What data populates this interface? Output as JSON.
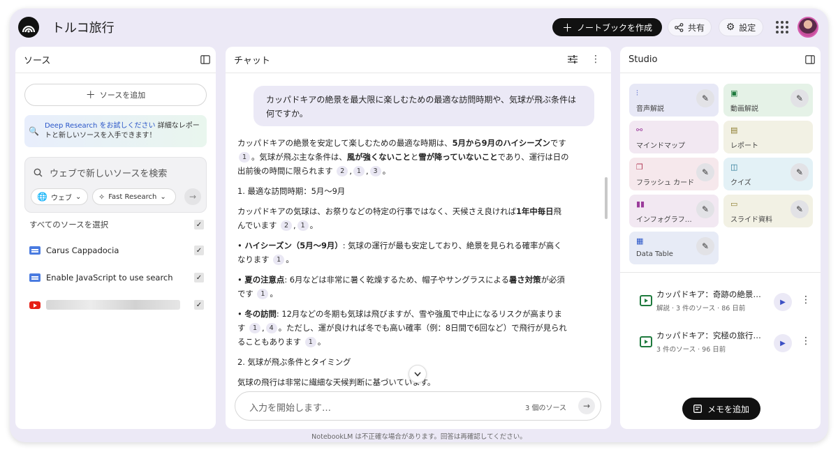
{
  "header": {
    "notebook_title": "トルコ旅行",
    "create_button": "ノートブックを作成",
    "share_button": "共有",
    "settings_button": "設定"
  },
  "sources": {
    "title": "ソース",
    "add_button": "ソースを追加",
    "deep_research_link": "Deep Research をお試しください",
    "deep_research_text": "詳細なレポートと新しいソースを入手できます！",
    "search_placeholder": "ウェブで新しいソースを検索",
    "web_chip": "ウェブ",
    "research_chip": "Fast Research",
    "select_all": "すべてのソースを選択",
    "items": [
      {
        "label": "Carus Cappadocia",
        "icon": "document-icon"
      },
      {
        "label": "Enable JavaScript to use search",
        "icon": "document-icon"
      },
      {
        "label": "",
        "icon": "youtube-icon"
      }
    ]
  },
  "chat": {
    "title": "チャット",
    "user_message": "カッパドキアの絶景を最大限に楽しむための最適な訪問時期や、気球が飛ぶ条件は何ですか。",
    "input_placeholder": "入力を開始します…",
    "source_count": "3 個のソース",
    "paragraphs": {
      "p1_a": "カッパドキアの絶景を安定して楽しむための最適な時期は、",
      "p1_b": "5月から9月のハイシーズン",
      "p1_c": "です",
      "p1_d": "。気球が飛ぶ主な条件は、",
      "p1_e": "風が強くないこと",
      "p1_f": "と",
      "p1_g": "雪が降っていないこと",
      "p1_h": "であり、運行は日の出前後の時間に限られます",
      "h1": "1. 最適な訪問時期：5月〜9月",
      "p2_a": "カッパドキアの気球は、お祭りなどの特定の行事ではなく、天候さえ良ければ",
      "p2_b": "1年中毎日",
      "p2_c": "飛んでいます",
      "b1_a": "• ",
      "b1_b": "ハイシーズン（5月〜9月）",
      "b1_c": ": 気球の運行が最も安定しており、絶景を見られる確率が高くなります",
      "b2_b": "夏の注意点",
      "b2_c": ": 6月などは非常に暑く乾燥するため、帽子やサングラスによる",
      "b2_d": "暑さ対策",
      "b2_e": "が必須です",
      "b3_b": "冬の訪問",
      "b3_c": ": 12月などの冬期も気球は飛びますが、雪や強風で中止になるリスクが高まります",
      "b3_d": "。ただし、運が良ければ冬でも高い確率（例：8日間で6回など）で飛行が見られることもあります",
      "h2": "2. 気球が飛ぶ条件とタイミング",
      "p3": "気球の飛行は非常に繊細な天候判断に基づいています。",
      "period": "。",
      "comma": ",",
      "c1": "1",
      "c2": "2",
      "c3": "3",
      "c4": "4"
    }
  },
  "studio": {
    "title": "Studio",
    "tiles": [
      {
        "label": "音声解説",
        "icon": "audio-wave-icon",
        "color": "#e7e8f6",
        "icon_color": "#3a4fc4"
      },
      {
        "label": "動画解説",
        "icon": "video-icon",
        "color": "#e5f2e7",
        "icon_color": "#1e7a3d"
      },
      {
        "label": "マインドマップ",
        "icon": "mindmap-icon",
        "color": "#f2e8f2",
        "icon_color": "#9b3c9b"
      },
      {
        "label": "レポート",
        "icon": "report-icon",
        "color": "#f2f1e4",
        "icon_color": "#8a7a2a"
      },
      {
        "label": "フラッシュ カード",
        "icon": "flashcard-icon",
        "color": "#f6e8ec",
        "icon_color": "#b23a56"
      },
      {
        "label": "クイズ",
        "icon": "quiz-icon",
        "color": "#e3f1f6",
        "icon_color": "#1d6f8f"
      },
      {
        "label": "インフォグラフ…",
        "icon": "infographic-icon",
        "color": "#f2e8f2",
        "icon_color": "#9b3c9b"
      },
      {
        "label": "スライド資料",
        "icon": "slides-icon",
        "color": "#f2f1e4",
        "icon_color": "#8a7a2a"
      },
      {
        "label": "Data Table",
        "icon": "table-icon",
        "color": "#e7ebf6",
        "icon_color": "#2a56c8"
      }
    ],
    "notes": [
      {
        "title": "カッパドキア：奇跡の絶景…",
        "meta": "解説 · 3 件のソース · 86 日前"
      },
      {
        "title": "カッパドキア：究極の旅行…",
        "meta": "3 件のソース · 96 日前"
      }
    ],
    "memo_button": "メモを追加"
  },
  "footer": "NotebookLM は不正確な場合があります。回答は再確認してください。"
}
